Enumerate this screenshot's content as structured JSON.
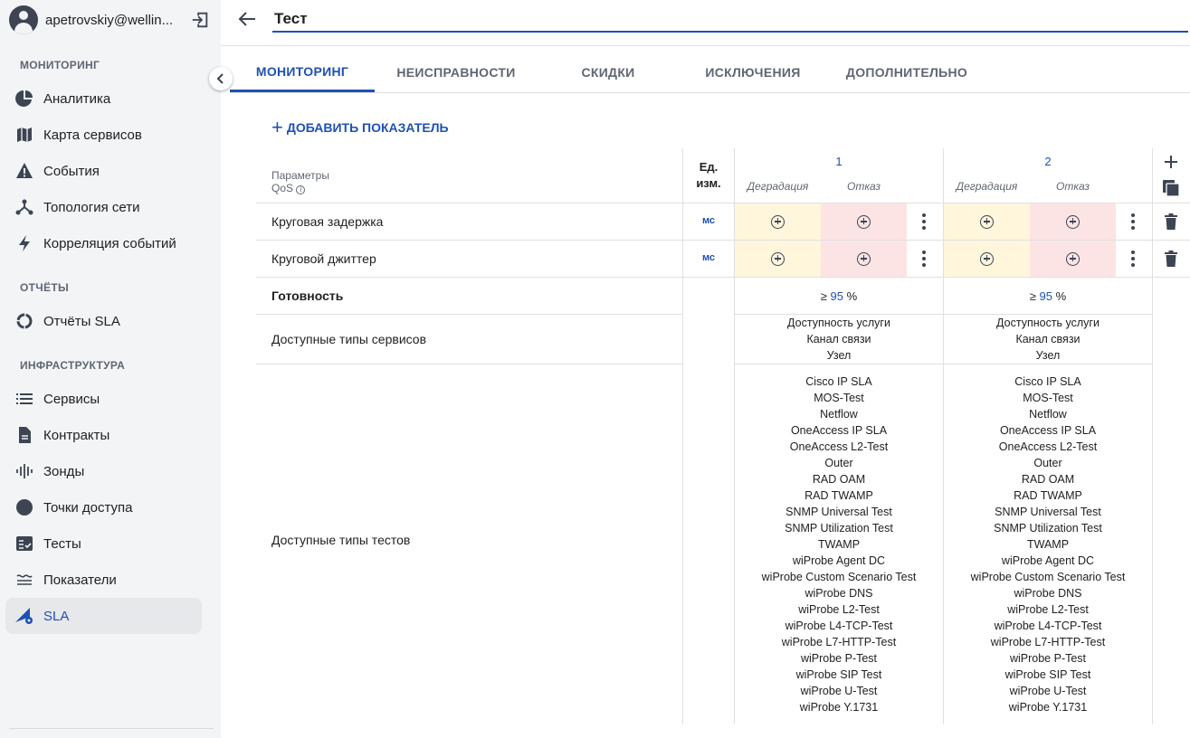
{
  "user": {
    "name": "apetrovskiy@wellin..."
  },
  "sidebar": {
    "sections": [
      {
        "title": "МОНИТОРИНГ",
        "items": [
          {
            "label": "Аналитика",
            "icon": "pie-chart-icon"
          },
          {
            "label": "Карта сервисов",
            "icon": "map-icon"
          },
          {
            "label": "События",
            "icon": "warning-icon"
          },
          {
            "label": "Топология сети",
            "icon": "topology-icon"
          },
          {
            "label": "Корреляция событий",
            "icon": "lightning-icon"
          }
        ]
      },
      {
        "title": "ОТЧЁТЫ",
        "items": [
          {
            "label": "Отчёты SLA",
            "icon": "report-ring-icon"
          }
        ]
      },
      {
        "title": "ИНФРАСТРУКТУРА",
        "items": [
          {
            "label": "Сервисы",
            "icon": "list-icon"
          },
          {
            "label": "Контракты",
            "icon": "document-icon"
          },
          {
            "label": "Зонды",
            "icon": "probe-icon"
          },
          {
            "label": "Точки доступа",
            "icon": "circle-icon"
          },
          {
            "label": "Тесты",
            "icon": "checklist-icon"
          },
          {
            "label": "Показатели",
            "icon": "indicators-icon"
          },
          {
            "label": "SLA",
            "icon": "sla-icon",
            "active": true
          }
        ]
      }
    ]
  },
  "header": {
    "title_value": "Тест"
  },
  "tabs": [
    {
      "label": "МОНИТОРИНГ",
      "active": true
    },
    {
      "label": "НЕИСПРАВНОСТИ"
    },
    {
      "label": "СКИДКИ"
    },
    {
      "label": "ИСКЛЮЧЕНИЯ"
    },
    {
      "label": "ДОПОЛНИТЕЛЬНО"
    }
  ],
  "add_indicator_label": "ДОБАВИТЬ ПОКАЗАТЕЛЬ",
  "table": {
    "params_header": "Параметры QoS",
    "unit_header_line1": "Ед.",
    "unit_header_line2": "изм.",
    "columns": [
      {
        "number": "1",
        "degradation": "Деградация",
        "failure": "Отказ"
      },
      {
        "number": "2",
        "degradation": "Деградация",
        "failure": "Отказ"
      }
    ],
    "rows": [
      {
        "label": "Круговая задержка",
        "unit": "мс"
      },
      {
        "label": "Круговой джиттер",
        "unit": "мс"
      }
    ],
    "availability": {
      "label": "Готовность",
      "operator": "≥",
      "value": "95",
      "unit": "%"
    },
    "service_types": {
      "label": "Доступные типы сервисов",
      "values": [
        "Доступность услуги",
        "Канал связи",
        "Узел"
      ]
    },
    "test_types": {
      "label": "Доступные типы тестов",
      "values": [
        "Cisco IP SLA",
        "MOS-Test",
        "Netflow",
        "OneAccess IP SLA",
        "OneAccess L2-Test",
        "Outer",
        "RAD OAM",
        "RAD TWAMP",
        "SNMP Universal Test",
        "SNMP Utilization Test",
        "TWAMP",
        "wiProbe Agent DC",
        "wiProbe Custom Scenario Test",
        "wiProbe DNS",
        "wiProbe L2-Test",
        "wiProbe L4-TCP-Test",
        "wiProbe L7-HTTP-Test",
        "wiProbe P-Test",
        "wiProbe SIP Test",
        "wiProbe U-Test",
        "wiProbe Y.1731"
      ]
    }
  },
  "colors": {
    "accent": "#1f50b4",
    "degradation_bg": "#fff6dc",
    "failure_bg": "#fce4e4"
  }
}
